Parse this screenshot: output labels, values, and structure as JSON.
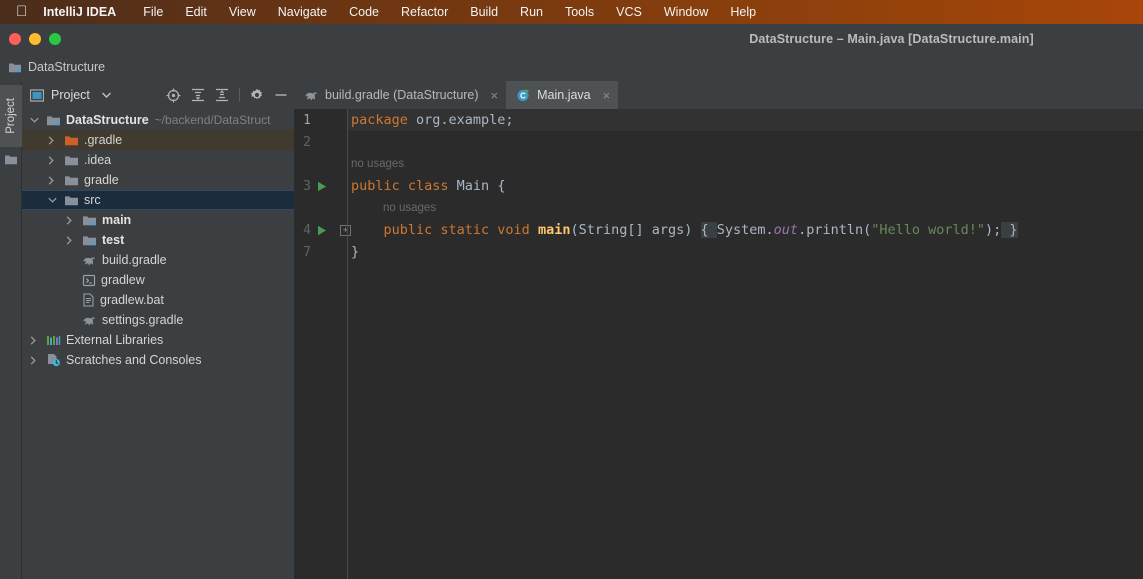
{
  "menubar": {
    "apple_icon": "apple-logo-icon",
    "app_name": "IntelliJ IDEA",
    "items": [
      "File",
      "Edit",
      "View",
      "Navigate",
      "Code",
      "Refactor",
      "Build",
      "Run",
      "Tools",
      "VCS",
      "Window",
      "Help"
    ]
  },
  "window": {
    "title": "DataStructure – Main.java [DataStructure.main]",
    "close_button": "close-window-button",
    "minimize_button": "minimize-window-button",
    "maximize_button": "maximize-window-button"
  },
  "breadcrumb": {
    "label": "DataStructure",
    "icon": "module-folder-icon"
  },
  "left_strip": {
    "project_tab": "Project",
    "folder_icon": "folder-icon"
  },
  "project_panel": {
    "title": "Project",
    "view_icon": "project-view-icon",
    "dropdown_caret": "chevron-down-icon",
    "actions": [
      {
        "name": "locate-icon",
        "title": "Select Opened File"
      },
      {
        "name": "expand-all-icon",
        "title": "Expand All"
      },
      {
        "name": "collapse-all-icon",
        "title": "Collapse All"
      },
      {
        "name": "gear-icon",
        "title": "Options"
      },
      {
        "name": "minimize-icon",
        "title": "Hide"
      }
    ],
    "tree": [
      {
        "label": "DataStructure",
        "path": "~/backend/DataStruct",
        "indent": 0,
        "arrow": "down",
        "icon": "module-folder-icon",
        "bold": true,
        "state": "normal"
      },
      {
        "label": ".gradle",
        "path": "",
        "indent": 1,
        "arrow": "right",
        "icon": "orange-folder-icon",
        "bold": false,
        "state": "hovered"
      },
      {
        "label": ".idea",
        "path": "",
        "indent": 1,
        "arrow": "right",
        "icon": "folder-icon",
        "bold": false,
        "state": "normal"
      },
      {
        "label": "gradle",
        "path": "",
        "indent": 1,
        "arrow": "right",
        "icon": "folder-icon",
        "bold": false,
        "state": "normal"
      },
      {
        "label": "src",
        "path": "",
        "indent": 1,
        "arrow": "down",
        "icon": "folder-icon",
        "bold": false,
        "state": "selected"
      },
      {
        "label": "main",
        "path": "",
        "indent": 2,
        "arrow": "right",
        "icon": "module-folder-icon",
        "bold": true,
        "state": "normal"
      },
      {
        "label": "test",
        "path": "",
        "indent": 2,
        "arrow": "right",
        "icon": "module-folder-icon",
        "bold": true,
        "state": "normal"
      },
      {
        "label": "build.gradle",
        "path": "",
        "indent": 2,
        "arrow": "none",
        "icon": "gradle-elephant-icon",
        "bold": false,
        "state": "normal"
      },
      {
        "label": "gradlew",
        "path": "",
        "indent": 2,
        "arrow": "none",
        "icon": "shell-script-icon",
        "bold": false,
        "state": "normal"
      },
      {
        "label": "gradlew.bat",
        "path": "",
        "indent": 2,
        "arrow": "none",
        "icon": "bat-script-icon",
        "bold": false,
        "state": "normal"
      },
      {
        "label": "settings.gradle",
        "path": "",
        "indent": 2,
        "arrow": "none",
        "icon": "gradle-elephant-icon",
        "bold": false,
        "state": "normal"
      },
      {
        "label": "External Libraries",
        "path": "",
        "indent": 0,
        "arrow": "right",
        "icon": "libraries-icon",
        "bold": false,
        "state": "normal"
      },
      {
        "label": "Scratches and Consoles",
        "path": "",
        "indent": 0,
        "arrow": "right",
        "icon": "scratches-icon",
        "bold": false,
        "state": "normal"
      }
    ]
  },
  "editor": {
    "tabs": [
      {
        "label": "build.gradle (DataStructure)",
        "icon": "gradle-elephant-icon",
        "active": false,
        "close": "×"
      },
      {
        "label": "Main.java",
        "icon": "java-runnable-class-icon",
        "active": true,
        "close": "×"
      }
    ],
    "lines": [
      {
        "number": "1",
        "run": false,
        "fold": false,
        "caret": true,
        "tokens": [
          {
            "t": "package ",
            "c": "kw"
          },
          {
            "t": "org.example;",
            "c": "plain"
          }
        ]
      },
      {
        "number": "2",
        "run": false,
        "fold": false,
        "caret": false,
        "tokens": []
      },
      {
        "number": "",
        "inlay": "no usages",
        "inlay_indent": 0
      },
      {
        "number": "3",
        "run": true,
        "fold": false,
        "caret": false,
        "tokens": [
          {
            "t": "public class ",
            "c": "kw"
          },
          {
            "t": "Main ",
            "c": "plain"
          },
          {
            "t": "{",
            "c": "plain"
          }
        ]
      },
      {
        "number": "",
        "inlay": "no usages",
        "inlay_indent": 1
      },
      {
        "number": "4",
        "run": true,
        "fold": true,
        "caret": false,
        "tokens": [
          {
            "t": "    public static void ",
            "c": "kw"
          },
          {
            "t": "main",
            "c": "fn"
          },
          {
            "t": "(String[] args) ",
            "c": "plain"
          },
          {
            "t": "{ ",
            "c": "fold-open"
          },
          {
            "t": "System.",
            "c": "plain"
          },
          {
            "t": "out",
            "c": "field"
          },
          {
            "t": ".println(",
            "c": "plain"
          },
          {
            "t": "\"Hello world!\"",
            "c": "str"
          },
          {
            "t": ");",
            "c": "plain"
          },
          {
            "t": " }",
            "c": "fold-close"
          }
        ]
      },
      {
        "number": "7",
        "run": false,
        "fold": false,
        "caret": false,
        "tokens": [
          {
            "t": "}",
            "c": "plain"
          }
        ]
      }
    ]
  },
  "colors": {
    "menubar_accent": "#8a3f0c",
    "panel_bg": "#3c3f41",
    "editor_bg": "#2b2b2b",
    "selection_blue": "#1b2c3d",
    "hover_brown": "#413a2e",
    "keyword_orange": "#cc7832",
    "string_green": "#6a8759",
    "method_yellow": "#ffc66d",
    "field_purple": "#9876aa",
    "run_green": "#499c54"
  }
}
